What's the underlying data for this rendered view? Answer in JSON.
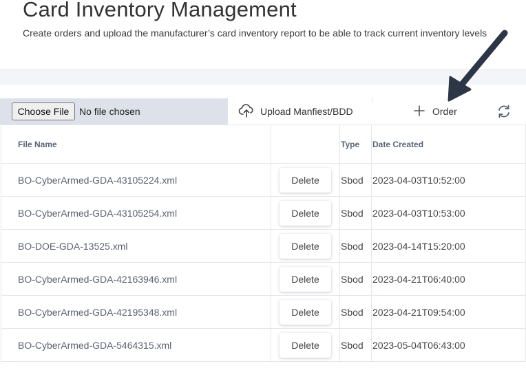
{
  "header": {
    "title": "Card Inventory Management",
    "description": "Create orders and upload the manufacturer’s card inventory report to be able to track current inventory levels"
  },
  "toolbar": {
    "choose_file_label": "Choose File",
    "no_file_text": "No file chosen",
    "upload_label": "Upload Manfiest/BDD",
    "order_label": "Order"
  },
  "table": {
    "columns": {
      "file_name": "File Name",
      "action": "",
      "type": "Type",
      "date_created": "Date Created"
    },
    "delete_label": "Delete",
    "rows": [
      {
        "file_name": "BO-CyberArmed-GDA-43105224.xml",
        "type": "Sbod",
        "date_created": "2023-04-03T10:52:00"
      },
      {
        "file_name": "BO-CyberArmed-GDA-43105254.xml",
        "type": "Sbod",
        "date_created": "2023-04-03T10:53:00"
      },
      {
        "file_name": "BO-DOE-GDA-13525.xml",
        "type": "Sbod",
        "date_created": "2023-04-14T15:20:00"
      },
      {
        "file_name": "BO-CyberArmed-GDA-42163946.xml",
        "type": "Sbod",
        "date_created": "2023-04-21T06:40:00"
      },
      {
        "file_name": "BO-CyberArmed-GDA-42195348.xml",
        "type": "Sbod",
        "date_created": "2023-04-21T09:54:00"
      },
      {
        "file_name": "BO-CyberArmed-GDA-5464315.xml",
        "type": "Sbod",
        "date_created": "2023-05-04T06:43:00"
      }
    ]
  },
  "icons": {
    "upload": "cloud-upload-icon",
    "order": "plus-icon",
    "refresh": "refresh-icon",
    "annotation": "arrow-pointer-icon"
  },
  "colors": {
    "file_area_bg": "#dde1ea",
    "band_bg": "#f3f5f9",
    "arrow": "#2c3646"
  }
}
